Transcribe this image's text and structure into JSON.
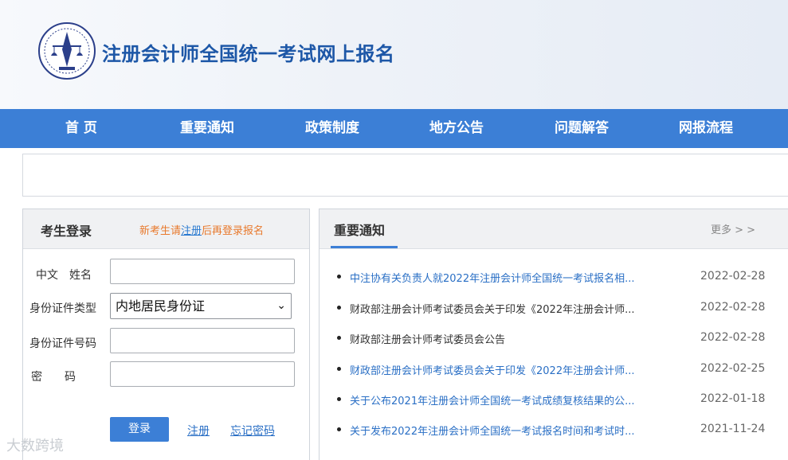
{
  "header": {
    "site_title": "注册会计师全国统一考试网上报名"
  },
  "nav": {
    "items": [
      "首 页",
      "重要通知",
      "政策制度",
      "地方公告",
      "问题解答",
      "网报流程"
    ]
  },
  "login": {
    "title": "考生登录",
    "hint_prefix": "新考生请",
    "hint_link": "注册",
    "hint_suffix": "后再登录报名",
    "name_label": "中文　姓名",
    "id_type_label": "身份证件类型",
    "id_type_value": "内地居民身份证",
    "id_number_label": "身份证件号码",
    "password_label": "密　　码",
    "login_button": "登录",
    "register_link": "注册",
    "forgot_link": "忘记密码"
  },
  "notices": {
    "title": "重要通知",
    "more": "更多 > >",
    "items": [
      {
        "text": "中注协有关负责人就2022年注册会计师全国统一考试报名相...",
        "date": "2022-02-28",
        "color": "#2a6fc5"
      },
      {
        "text": "财政部注册会计师考试委员会关于印发《2022年注册会计师...",
        "date": "2022-02-28",
        "color": "#333333"
      },
      {
        "text": "财政部注册会计师考试委员会公告",
        "date": "2022-02-28",
        "color": "#333333"
      },
      {
        "text": "财政部注册会计师考试委员会关于印发《2022年注册会计师...",
        "date": "2022-02-25",
        "color": "#2a6fc5"
      },
      {
        "text": "关于公布2021年注册会计师全国统一考试成绩复核结果的公...",
        "date": "2022-01-18",
        "color": "#2a6fc5"
      },
      {
        "text": "关于发布2022年注册会计师全国统一考试报名时间和考试时...",
        "date": "2021-11-24",
        "color": "#2a6fc5"
      }
    ]
  },
  "watermark": "大数跨境",
  "colors": {
    "brand_blue": "#3c7fd6",
    "title_blue": "#1d57a7",
    "hint_orange": "#e8792c"
  }
}
